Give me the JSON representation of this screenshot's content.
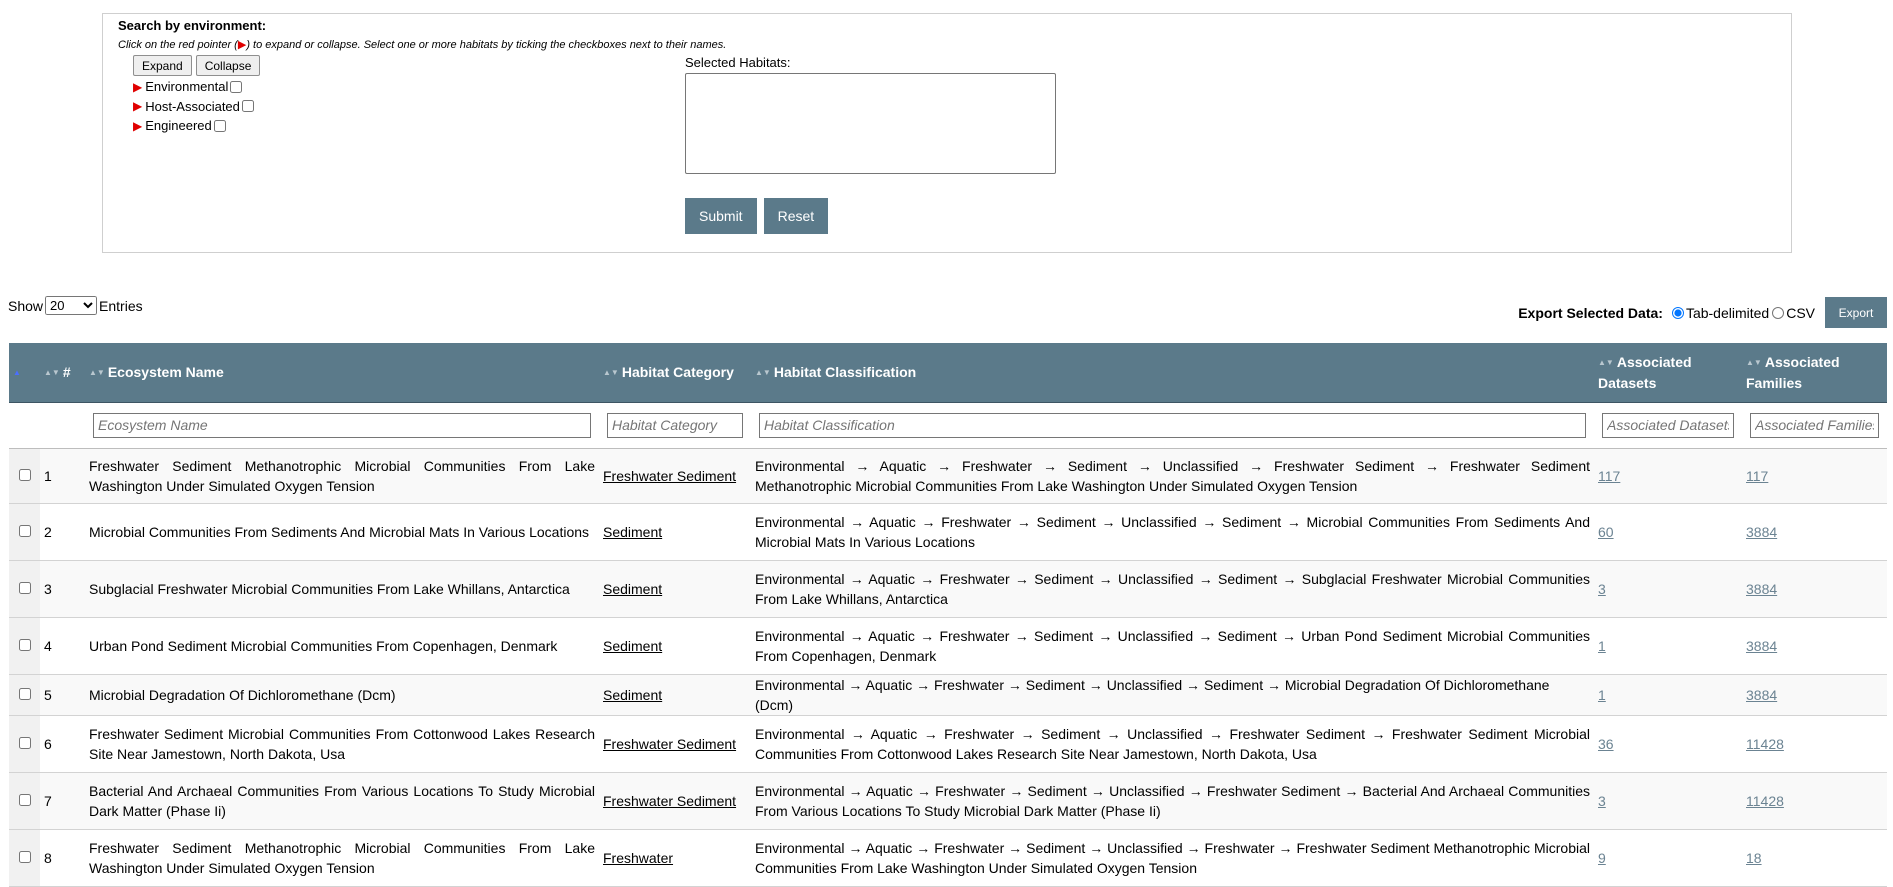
{
  "search": {
    "title": "Search by environment:",
    "hint_before": "Click on the red pointer (",
    "hint_pointer": "▶",
    "hint_after": ") to expand or collapse. Select one or more habitats by ticking the checkboxes next to their names.",
    "expand_label": "Expand",
    "collapse_label": "Collapse",
    "tree": [
      "Environmental",
      "Host-Associated",
      "Engineered"
    ],
    "selected_label": "Selected Habitats:",
    "submit_label": "Submit",
    "reset_label": "Reset"
  },
  "controls": {
    "show_label": "Show",
    "entries_value": "20",
    "entries_label": "Entries",
    "export_label": "Export Selected Data:",
    "radio_tab": "Tab-delimited",
    "radio_csv": "CSV",
    "export_button": "Export"
  },
  "table": {
    "headers": {
      "num": "#",
      "ecosystem": "Ecosystem Name",
      "category": "Habitat Category",
      "classification": "Habitat Classification",
      "datasets": "Associated Datasets",
      "families": "Associated Families"
    },
    "filters": {
      "ecosystem": "Ecosystem Name",
      "category": "Habitat Category",
      "classification": "Habitat Classification",
      "datasets": "Associated Datasets",
      "families": "Associated Families"
    },
    "rows": [
      {
        "num": "1",
        "ecosystem": "Freshwater Sediment Methanotrophic Microbial Communities From Lake Washington Under Simulated Oxygen Tension",
        "category": "Freshwater Sediment",
        "classification": "Environmental → Aquatic → Freshwater → Sediment → Unclassified → Freshwater Sediment → Freshwater Sediment Methanotrophic Microbial Communities From Lake Washington Under Simulated Oxygen Tension",
        "datasets": "117",
        "families": "117"
      },
      {
        "num": "2",
        "ecosystem": "Microbial Communities From Sediments And Microbial Mats In Various Locations",
        "category": "Sediment",
        "classification": "Environmental → Aquatic → Freshwater → Sediment → Unclassified → Sediment → Microbial Communities From Sediments And Microbial Mats In Various Locations",
        "datasets": "60",
        "families": "3884"
      },
      {
        "num": "3",
        "ecosystem": "Subglacial Freshwater Microbial Communities From Lake Whillans, Antarctica",
        "category": "Sediment",
        "classification": "Environmental → Aquatic → Freshwater → Sediment → Unclassified → Sediment → Subglacial Freshwater Microbial Communities From Lake Whillans, Antarctica",
        "datasets": "3",
        "families": "3884"
      },
      {
        "num": "4",
        "ecosystem": "Urban Pond Sediment Microbial Communities From Copenhagen, Denmark",
        "category": "Sediment",
        "classification": "Environmental → Aquatic → Freshwater → Sediment → Unclassified → Sediment → Urban Pond Sediment Microbial Communities From Copenhagen, Denmark",
        "datasets": "1",
        "families": "3884"
      },
      {
        "num": "5",
        "ecosystem": "Microbial Degradation Of Dichloromethane (Dcm)",
        "category": "Sediment",
        "classification": "Environmental → Aquatic → Freshwater → Sediment → Unclassified → Sediment → Microbial Degradation Of Dichloromethane (Dcm)",
        "datasets": "1",
        "families": "3884"
      },
      {
        "num": "6",
        "ecosystem": "Freshwater Sediment Microbial Communities From Cottonwood Lakes Research Site Near Jamestown, North Dakota, Usa",
        "category": "Freshwater Sediment",
        "classification": "Environmental → Aquatic → Freshwater → Sediment → Unclassified → Freshwater Sediment → Freshwater Sediment Microbial Communities From Cottonwood Lakes Research Site Near Jamestown, North Dakota, Usa",
        "datasets": "36",
        "families": "11428"
      },
      {
        "num": "7",
        "ecosystem": "Bacterial And Archaeal Communities From Various Locations To Study Microbial Dark Matter (Phase Ii)",
        "category": "Freshwater Sediment",
        "classification": "Environmental → Aquatic → Freshwater → Sediment → Unclassified → Freshwater Sediment → Bacterial And Archaeal Communities From Various Locations To Study Microbial Dark Matter (Phase Ii)",
        "datasets": "3",
        "families": "11428"
      },
      {
        "num": "8",
        "ecosystem": "Freshwater Sediment Methanotrophic Microbial Communities From Lake Washington Under Simulated Oxygen Tension",
        "category": "Freshwater",
        "classification": "Environmental → Aquatic → Freshwater → Sediment → Unclassified → Freshwater → Freshwater Sediment Methanotrophic Microbial Communities From Lake Washington Under Simulated Oxygen Tension",
        "datasets": "9",
        "families": "18"
      }
    ]
  }
}
